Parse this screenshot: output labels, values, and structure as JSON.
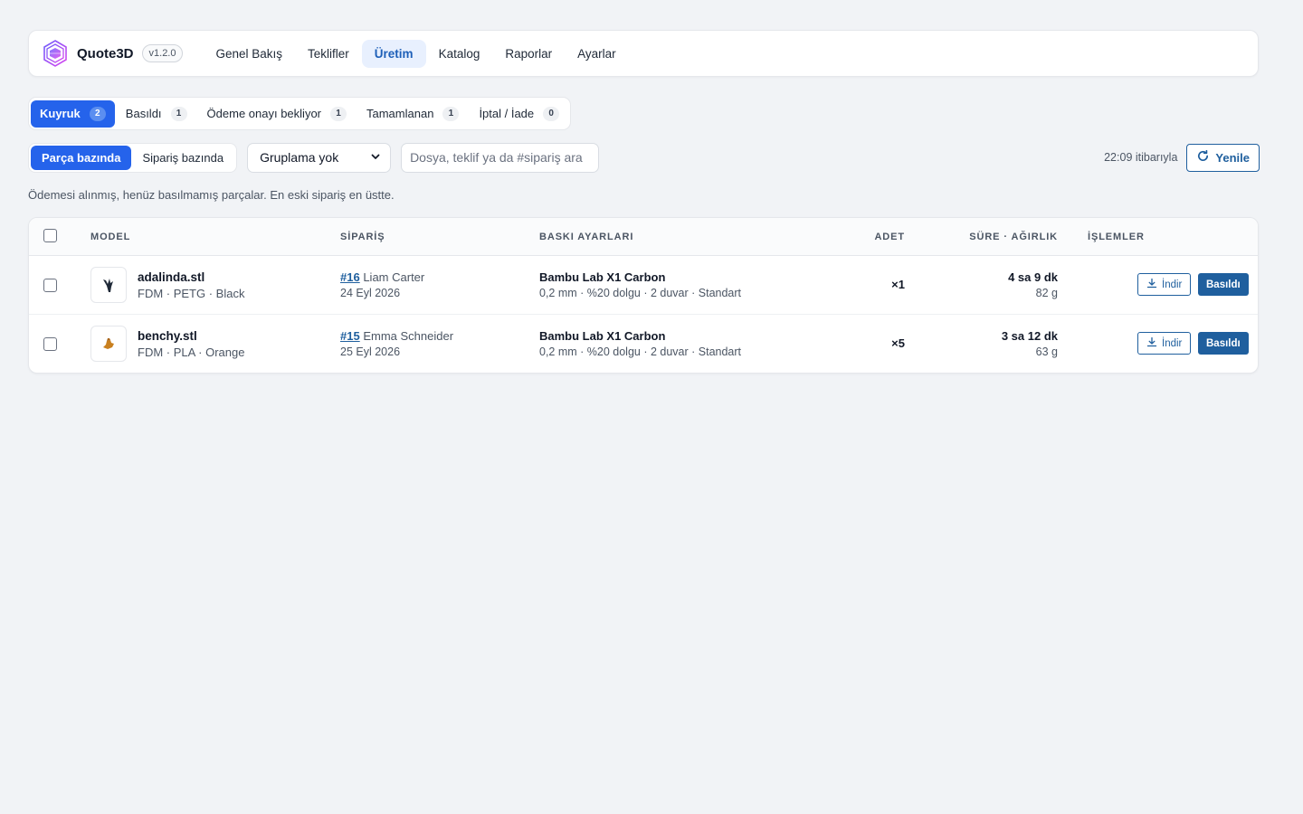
{
  "app": {
    "name": "Quote3D",
    "version": "v1.2.0",
    "logo_icon": "quote3d-logo-icon"
  },
  "nav": {
    "items": [
      {
        "label": "Genel Bakış",
        "active": false
      },
      {
        "label": "Teklifler",
        "active": false
      },
      {
        "label": "Üretim",
        "active": true
      },
      {
        "label": "Katalog",
        "active": false
      },
      {
        "label": "Raporlar",
        "active": false
      },
      {
        "label": "Ayarlar",
        "active": false
      }
    ]
  },
  "tabs": [
    {
      "label": "Kuyruk",
      "count": "2",
      "active": true
    },
    {
      "label": "Basıldı",
      "count": "1",
      "active": false
    },
    {
      "label": "Ödeme onayı bekliyor",
      "count": "1",
      "active": false
    },
    {
      "label": "Tamamlanan",
      "count": "1",
      "active": false
    },
    {
      "label": "İptal / İade",
      "count": "0",
      "active": false
    }
  ],
  "toolbar": {
    "view_modes": [
      {
        "label": "Parça bazında",
        "active": true
      },
      {
        "label": "Sipariş bazında",
        "active": false
      }
    ],
    "grouping": {
      "selected": "Gruplama yok"
    },
    "search": {
      "placeholder": "Dosya, teklif ya da #sipariş ara",
      "value": ""
    },
    "as_of": "22:09 itibarıyla",
    "refresh_label": "Yenile"
  },
  "description": "Ödemesi alınmış, henüz basılmamış parçalar. En eski sipariş en üstte.",
  "table": {
    "columns": {
      "model": "MODEL",
      "order": "SİPARİŞ",
      "print_settings": "BASKI AYARLARI",
      "qty": "ADET",
      "duration_weight": "SÜRE · AĞIRLIK",
      "actions": "İŞLEMLER"
    },
    "rows": [
      {
        "file": "adalinda.stl",
        "meta": "FDM · PETG · Black",
        "thumb_color": "#1f2937",
        "order_no": "#16",
        "customer": "Liam Carter",
        "date": "24 Eyl 2026",
        "printer": "Bambu Lab X1 Carbon",
        "settings": "0,2 mm · %20 dolgu · 2 duvar · Standart",
        "qty": "×1",
        "duration": "4 sa 9 dk",
        "weight": "82 g",
        "download_label": "İndir",
        "printed_label": "Basıldı"
      },
      {
        "file": "benchy.stl",
        "meta": "FDM · PLA · Orange",
        "thumb_color": "#c9801f",
        "order_no": "#15",
        "customer": "Emma Schneider",
        "date": "25 Eyl 2026",
        "printer": "Bambu Lab X1 Carbon",
        "settings": "0,2 mm · %20 dolgu · 2 duvar · Standart",
        "qty": "×5",
        "duration": "3 sa 12 dk",
        "weight": "63 g",
        "download_label": "İndir",
        "printed_label": "Basıldı"
      }
    ]
  },
  "colors": {
    "accent": "#2563eb",
    "action": "#1f5f9e",
    "background": "#f1f3f6"
  }
}
